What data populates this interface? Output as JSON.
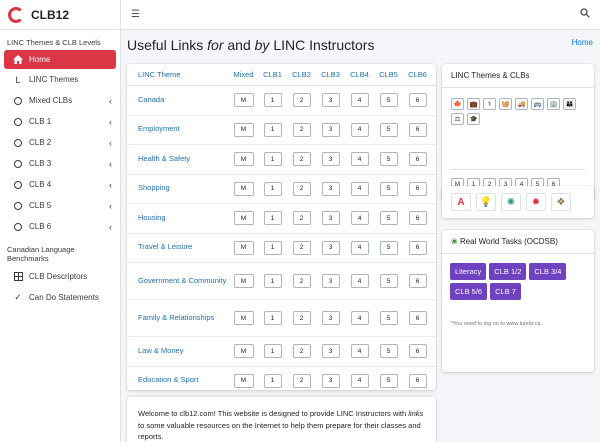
{
  "brand": {
    "name": "CLB12"
  },
  "sidebar": {
    "section1": "LINC Themes & CLB Levels",
    "items": [
      {
        "label": "Home",
        "icon": "home-icon",
        "active": true
      },
      {
        "label": "LINC Themes",
        "icon": "l-icon"
      },
      {
        "label": "Mixed CLBs",
        "icon": "circle-icon",
        "chevron": true
      },
      {
        "label": "CLB 1",
        "icon": "circle-icon",
        "chevron": true
      },
      {
        "label": "CLB 2",
        "icon": "circle-icon",
        "chevron": true
      },
      {
        "label": "CLB 3",
        "icon": "circle-icon",
        "chevron": true
      },
      {
        "label": "CLB 4",
        "icon": "circle-icon",
        "chevron": true
      },
      {
        "label": "CLB 5",
        "icon": "circle-icon",
        "chevron": true
      },
      {
        "label": "CLB 6",
        "icon": "circle-icon",
        "chevron": true
      }
    ],
    "section2": "Canadian Language Benchmarks",
    "items2": [
      {
        "label": "CLB Descriptors",
        "icon": "grid-icon"
      },
      {
        "label": "Can Do Statements",
        "icon": "check-icon"
      }
    ]
  },
  "topbar": {
    "menu_icon": "menu-icon",
    "search_icon": "search-icon"
  },
  "page": {
    "title_a": "Useful Links ",
    "title_for": "for",
    "title_b": " and ",
    "title_by": "by",
    "title_c": " LINC Instructors",
    "breadcrumb": "Home"
  },
  "table": {
    "headers": [
      "LINC Theme",
      "Mixed",
      "CLB1",
      "CLB2",
      "CLB3",
      "CLB4",
      "CLB5",
      "CLB6"
    ],
    "level_labels": [
      "M",
      "1",
      "2",
      "3",
      "4",
      "5",
      "6"
    ],
    "rows": [
      "Canada",
      "Employment",
      "Health & Safety",
      "Shopping",
      "Housing",
      "Travel & Leisure",
      "Government & Community",
      "Family & Relationships",
      "Law & Money",
      "Education & Sport"
    ]
  },
  "welcome": {
    "text_a": "Welcome to clb12.com! This website is designed to provide LINC Instructors with ",
    "text_links": "links",
    "text_b": " to some valuable resources on the Internet to help them prepare for their classes and reports."
  },
  "themes_card": {
    "title": "LINC Themes & CLBs",
    "theme_icons": [
      "maple-leaf-icon",
      "briefcase-icon",
      "stethoscope-icon",
      "basket-icon",
      "truck-icon",
      "bus-icon",
      "building-icon",
      "family-icon",
      "law-icon",
      "graduation-icon"
    ],
    "clb_labels": [
      "M",
      "1",
      "2",
      "3",
      "4",
      "5",
      "6"
    ]
  },
  "logos": [
    "tutela-logo",
    "idea-logo",
    "ircc-logo",
    "cbc-logo",
    "settlement-logo"
  ],
  "tasks_card": {
    "title": "Real World Tasks (OCDSB)",
    "buttons": [
      "Literacy",
      "CLB 1/2",
      "CLB 3/4",
      "CLB 5/6",
      "CLB 7"
    ],
    "note": "*You need to log on to www.tutela.ca."
  },
  "colors": {
    "accent": "#dc3545",
    "link": "#1f6fae",
    "task": "#6f42c1"
  }
}
